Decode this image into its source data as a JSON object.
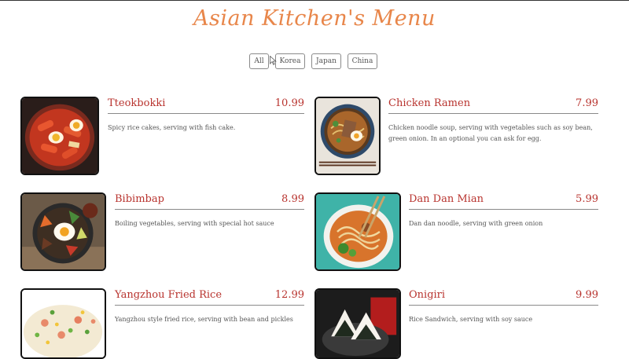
{
  "title": "Asian Kitchen's Menu",
  "filters": [
    "All",
    "Korea",
    "Japan",
    "China"
  ],
  "items": [
    {
      "name": "Tteokbokki",
      "price": "10.99",
      "desc": "Spicy rice cakes, serving with fish cake."
    },
    {
      "name": "Chicken Ramen",
      "price": "7.99",
      "desc": "Chicken noodle soup, serving with vegetables such as soy bean, green onion. In an optional you can ask for egg."
    },
    {
      "name": "Bibimbap",
      "price": "8.99",
      "desc": "Boiling vegetables, serving with special hot sauce"
    },
    {
      "name": "Dan Dan Mian",
      "price": "5.99",
      "desc": "Dan dan noodle, serving with green onion"
    },
    {
      "name": "Yangzhou Fried Rice",
      "price": "12.99",
      "desc": "Yangzhou style fried rice, serving with bean and pickles"
    },
    {
      "name": "Onigiri",
      "price": "9.99",
      "desc": "Rice Sandwich, serving with soy sauce"
    }
  ],
  "colors": {
    "title": "#e8864a",
    "accent": "#b8332e"
  }
}
